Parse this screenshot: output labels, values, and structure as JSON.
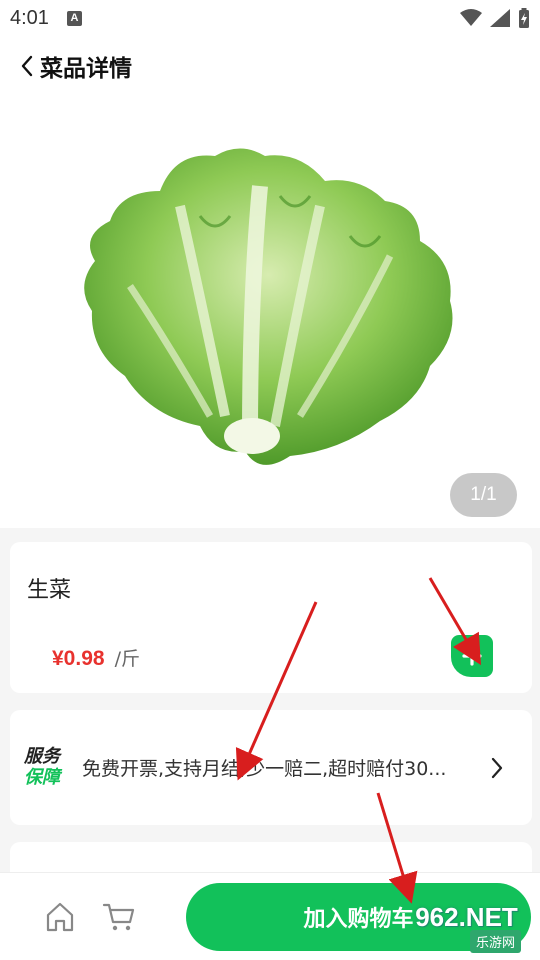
{
  "status_bar": {
    "time": "4:01",
    "notif": "A"
  },
  "header": {
    "title": "菜品详情"
  },
  "gallery": {
    "indicator": "1/1"
  },
  "product": {
    "name": "生菜",
    "price": "¥0.98",
    "unit": "/斤"
  },
  "service": {
    "logo_line1": "服务",
    "logo_line2": "保障",
    "text": "免费开票,支持月结,少一赔二,超时赔付30..."
  },
  "bottom": {
    "add_to_cart": "加入购物车"
  },
  "watermark": {
    "number": "962.NET",
    "site": "乐游网"
  },
  "colors": {
    "accent": "#12c15a",
    "price": "#e8322e",
    "annotation": "#d81e1e"
  }
}
